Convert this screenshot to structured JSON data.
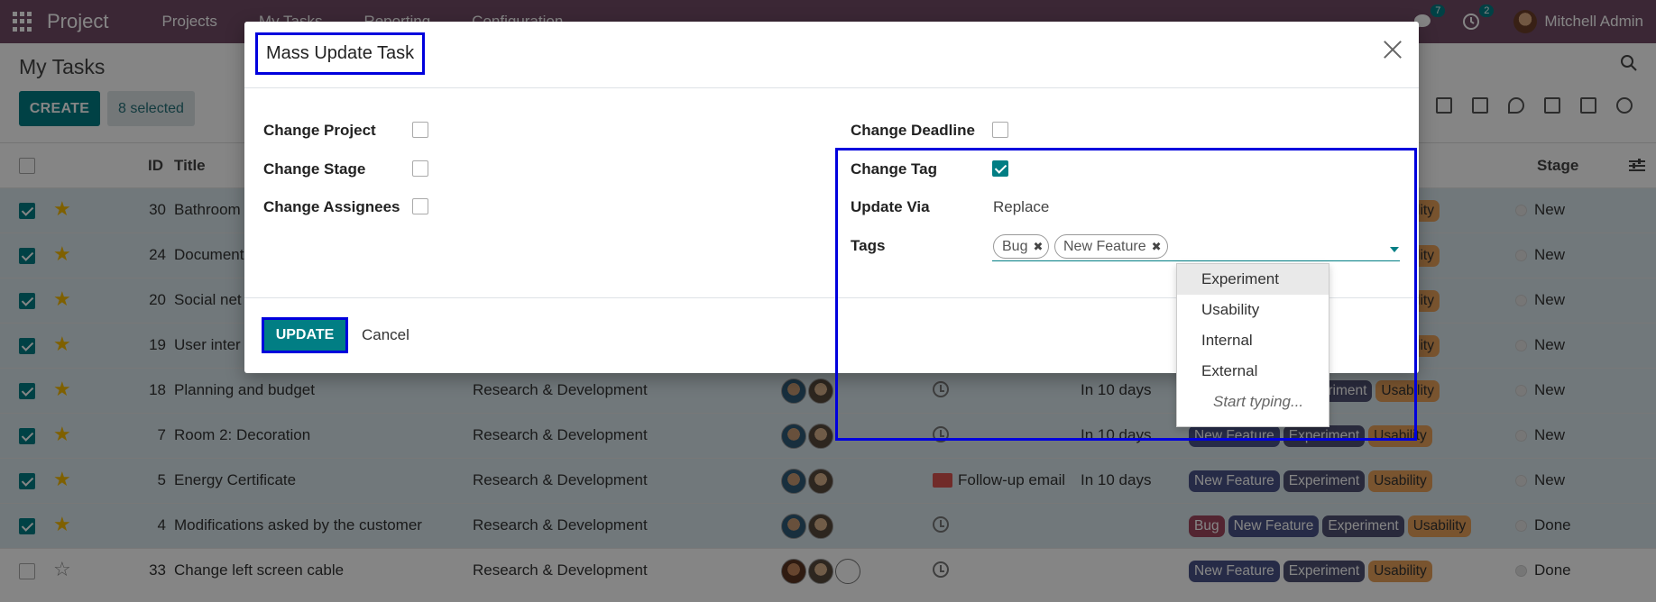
{
  "app": {
    "brand": "Project",
    "menu": [
      "Projects",
      "My Tasks",
      "Reporting",
      "Configuration"
    ],
    "messages_count": "7",
    "activities_count": "2",
    "user_name": "Mitchell Admin"
  },
  "control_panel": {
    "breadcrumb": "My Tasks",
    "create_label": "CREATE",
    "selected_label": "8 selected"
  },
  "table": {
    "headers": {
      "id": "ID",
      "title": "Title",
      "stage": "Stage"
    },
    "rows": [
      {
        "id": "30",
        "title": "Bathroom",
        "project": "",
        "deadline": "",
        "activity": "",
        "tags": [
          "Usability"
        ],
        "stage": "New",
        "selected": true,
        "starred": true
      },
      {
        "id": "24",
        "title": "Document",
        "project": "",
        "deadline": "",
        "activity": "",
        "tags": [
          "Usability"
        ],
        "stage": "New",
        "selected": true,
        "starred": true
      },
      {
        "id": "20",
        "title": "Social net",
        "project": "",
        "deadline": "",
        "activity": "",
        "tags": [
          "Usability"
        ],
        "stage": "New",
        "selected": true,
        "starred": true
      },
      {
        "id": "19",
        "title": "User inter",
        "project": "",
        "deadline": "",
        "activity": "",
        "tags": [
          "Usability"
        ],
        "stage": "New",
        "selected": true,
        "starred": true
      },
      {
        "id": "18",
        "title": "Planning and budget",
        "project": "Research & Development",
        "deadline": "In 10 days",
        "activity": "",
        "tags": [
          "Experiment",
          "Usability"
        ],
        "stage": "New",
        "selected": true,
        "starred": true
      },
      {
        "id": "7",
        "title": "Room 2: Decoration",
        "project": "Research & Development",
        "deadline": "In 10 days",
        "activity": "",
        "tags": [
          "New Feature",
          "Experiment",
          "Usability"
        ],
        "stage": "New",
        "selected": true,
        "starred": true
      },
      {
        "id": "5",
        "title": "Energy Certificate",
        "project": "Research & Development",
        "deadline": "In 10 days",
        "activity": "Follow-up email",
        "tags": [
          "New Feature",
          "Experiment",
          "Usability"
        ],
        "stage": "New",
        "selected": true,
        "starred": true
      },
      {
        "id": "4",
        "title": "Modifications asked by the customer",
        "project": "Research & Development",
        "deadline": "",
        "activity": "",
        "tags": [
          "Bug",
          "New Feature",
          "Experiment",
          "Usability"
        ],
        "stage": "Done",
        "selected": true,
        "starred": true
      },
      {
        "id": "33",
        "title": "Change left screen cable",
        "project": "Research & Development",
        "deadline": "",
        "activity": "",
        "tags": [
          "New Feature",
          "Experiment",
          "Usability"
        ],
        "stage": "Done",
        "selected": false,
        "starred": false
      }
    ]
  },
  "modal": {
    "title": "Mass Update Task",
    "fields_left": [
      {
        "label": "Change Project",
        "checked": false
      },
      {
        "label": "Change Stage",
        "checked": false
      },
      {
        "label": "Change Assignees",
        "checked": false
      }
    ],
    "change_deadline_label": "Change Deadline",
    "change_tag_label": "Change Tag",
    "update_via_label": "Update Via",
    "update_via_value": "Replace",
    "tags_label": "Tags",
    "selected_tags": [
      "Bug",
      "New Feature"
    ],
    "dropdown_options": [
      "Experiment",
      "Usability",
      "Internal",
      "External"
    ],
    "dropdown_hint": "Start typing...",
    "update_label": "UPDATE",
    "cancel_label": "Cancel"
  },
  "colors": {
    "navbar": "#714B67",
    "primary": "#017E84",
    "highlight": "#0000dd"
  }
}
